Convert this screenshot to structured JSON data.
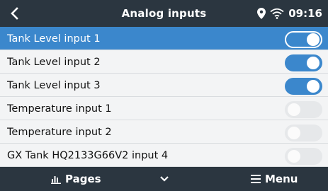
{
  "header": {
    "title": "Analog inputs",
    "time": "09:16"
  },
  "items": [
    {
      "label": "Tank Level input 1",
      "enabled": true,
      "selected": true
    },
    {
      "label": "Tank Level input 2",
      "enabled": true,
      "selected": false
    },
    {
      "label": "Tank Level input 3",
      "enabled": true,
      "selected": false
    },
    {
      "label": "Temperature input 1",
      "enabled": false,
      "selected": false
    },
    {
      "label": "Temperature input 2",
      "enabled": false,
      "selected": false
    },
    {
      "label": "GX Tank HQ2133G66V2 input 4",
      "enabled": false,
      "selected": false
    }
  ],
  "footer": {
    "pages_label": "Pages",
    "menu_label": "Menu"
  },
  "colors": {
    "bar": "#2b3640",
    "accent": "#3b87cc",
    "row_bg": "#f3f4f5",
    "switch_off": "#e6e8ea"
  }
}
